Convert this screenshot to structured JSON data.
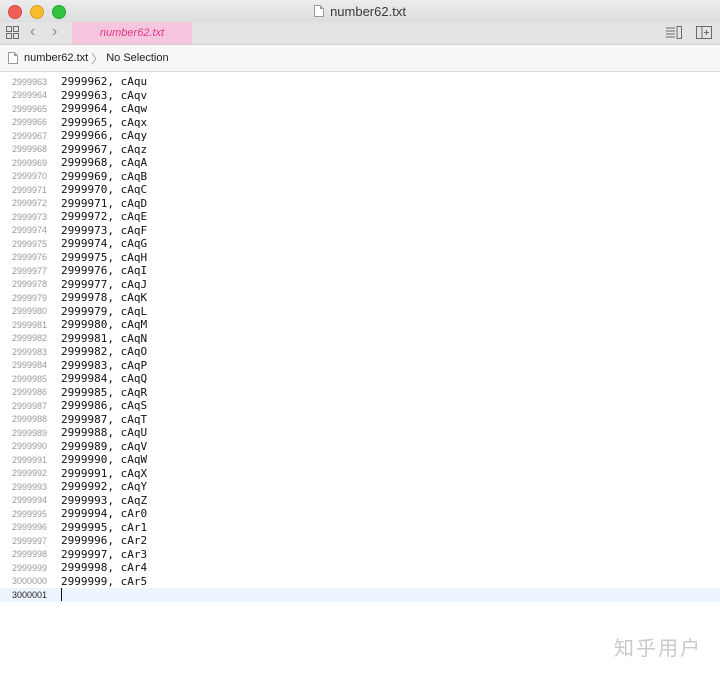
{
  "window": {
    "title": "number62.txt"
  },
  "tab": {
    "label": "number62.txt",
    "close": "✕"
  },
  "breadcrumb": {
    "file": "number62.txt",
    "location": "No Selection"
  },
  "editor": {
    "lines": [
      {
        "num": "2999963",
        "text": "2999962, cAqu"
      },
      {
        "num": "2999964",
        "text": "2999963, cAqv"
      },
      {
        "num": "2999965",
        "text": "2999964, cAqw"
      },
      {
        "num": "2999966",
        "text": "2999965, cAqx"
      },
      {
        "num": "2999967",
        "text": "2999966, cAqy"
      },
      {
        "num": "2999968",
        "text": "2999967, cAqz"
      },
      {
        "num": "2999969",
        "text": "2999968, cAqA"
      },
      {
        "num": "2999970",
        "text": "2999969, cAqB"
      },
      {
        "num": "2999971",
        "text": "2999970, cAqC"
      },
      {
        "num": "2999972",
        "text": "2999971, cAqD"
      },
      {
        "num": "2999973",
        "text": "2999972, cAqE"
      },
      {
        "num": "2999974",
        "text": "2999973, cAqF"
      },
      {
        "num": "2999975",
        "text": "2999974, cAqG"
      },
      {
        "num": "2999976",
        "text": "2999975, cAqH"
      },
      {
        "num": "2999977",
        "text": "2999976, cAqI"
      },
      {
        "num": "2999978",
        "text": "2999977, cAqJ"
      },
      {
        "num": "2999979",
        "text": "2999978, cAqK"
      },
      {
        "num": "2999980",
        "text": "2999979, cAqL"
      },
      {
        "num": "2999981",
        "text": "2999980, cAqM"
      },
      {
        "num": "2999982",
        "text": "2999981, cAqN"
      },
      {
        "num": "2999983",
        "text": "2999982, cAqO"
      },
      {
        "num": "2999984",
        "text": "2999983, cAqP"
      },
      {
        "num": "2999985",
        "text": "2999984, cAqQ"
      },
      {
        "num": "2999986",
        "text": "2999985, cAqR"
      },
      {
        "num": "2999987",
        "text": "2999986, cAqS"
      },
      {
        "num": "2999988",
        "text": "2999987, cAqT"
      },
      {
        "num": "2999989",
        "text": "2999988, cAqU"
      },
      {
        "num": "2999990",
        "text": "2999989, cAqV"
      },
      {
        "num": "2999991",
        "text": "2999990, cAqW"
      },
      {
        "num": "2999992",
        "text": "2999991, cAqX"
      },
      {
        "num": "2999993",
        "text": "2999992, cAqY"
      },
      {
        "num": "2999994",
        "text": "2999993, cAqZ"
      },
      {
        "num": "2999995",
        "text": "2999994, cAr0"
      },
      {
        "num": "2999996",
        "text": "2999995, cAr1"
      },
      {
        "num": "2999997",
        "text": "2999996, cAr2"
      },
      {
        "num": "2999998",
        "text": "2999997, cAr3"
      },
      {
        "num": "2999999",
        "text": "2999998, cAr4"
      },
      {
        "num": "3000000",
        "text": "2999999, cAr5"
      },
      {
        "num": "3000001",
        "text": ""
      }
    ],
    "current_line": "3000001"
  },
  "watermark": {
    "text": "知乎用户"
  },
  "colors": {
    "tab_bg": "#f6c6de",
    "tab_text": "#e0398a",
    "current_line_bg": "#ecf5fe"
  },
  "icons": [
    "grid-icon",
    "chevron-left-icon",
    "chevron-right-icon",
    "document-icon",
    "list-view-icon",
    "split-view-icon"
  ]
}
